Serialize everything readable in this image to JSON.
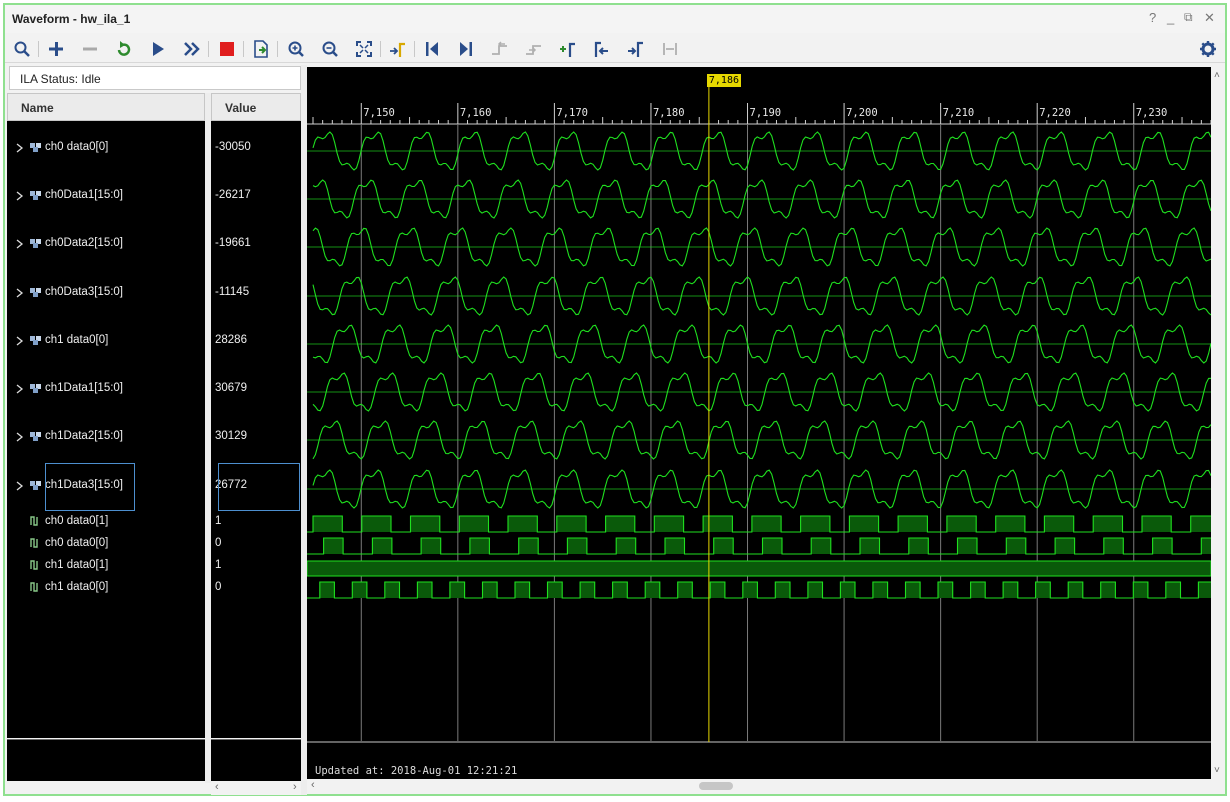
{
  "window": {
    "title": "Waveform - hw_ila_1",
    "help": "?",
    "minimize": "_",
    "restore": "⧉",
    "close": "✕"
  },
  "toolbar": {
    "icons": [
      "search-icon",
      "add-icon",
      "remove-icon",
      "run-trigger-immediate-icon",
      "run-trigger-icon",
      "run-trigger-continuous-icon",
      "stop-icon",
      "export-icon",
      "zoom-in-icon",
      "zoom-out-icon",
      "zoom-fit-icon",
      "go-to-cursor-icon",
      "go-to-start-icon",
      "go-to-end-icon",
      "previous-transition-icon",
      "next-transition-icon",
      "add-marker-icon",
      "previous-marker-icon",
      "next-marker-icon",
      "swap-cursors-icon",
      "settings-gear-icon"
    ]
  },
  "status": {
    "text": "ILA Status: Idle"
  },
  "columns": {
    "name": "Name",
    "value": "Value"
  },
  "signals": [
    {
      "name": "ch0 data0[0]",
      "value": "-30050",
      "kind": "bus"
    },
    {
      "name": "ch0Data1[15:0]",
      "value": "-26217",
      "kind": "bus"
    },
    {
      "name": "ch0Data2[15:0]",
      "value": "-19661",
      "kind": "bus"
    },
    {
      "name": "ch0Data3[15:0]",
      "value": "-11145",
      "kind": "bus"
    },
    {
      "name": "ch1 data0[0]",
      "value": "28286",
      "kind": "bus"
    },
    {
      "name": "ch1Data1[15:0]",
      "value": "30679",
      "kind": "bus"
    },
    {
      "name": "ch1Data2[15:0]",
      "value": "30129",
      "kind": "bus"
    },
    {
      "name": "ch1Data3[15:0]",
      "value": "26772",
      "kind": "bus",
      "selected": true
    },
    {
      "name": "ch0 data0[1]",
      "value": "1",
      "kind": "bit"
    },
    {
      "name": "ch0 data0[0]",
      "value": "0",
      "kind": "bit"
    },
    {
      "name": "ch1 data0[1]",
      "value": "1",
      "kind": "bit"
    },
    {
      "name": "ch1 data0[0]",
      "value": "0",
      "kind": "bit"
    }
  ],
  "waveform": {
    "cursor_label": "7,186",
    "cursor_time": 7186,
    "time_start": 7145,
    "time_end": 7238,
    "major_ticks": [
      "7,150",
      "7,160",
      "7,170",
      "7,180",
      "7,190",
      "7,200",
      "7,210",
      "7,220",
      "7,230"
    ],
    "updated": "Updated at: 2018-Aug-01 12:21:21",
    "trace_color": "#1fe01f",
    "background": "#000000",
    "cursor_color": "#e6d800"
  }
}
